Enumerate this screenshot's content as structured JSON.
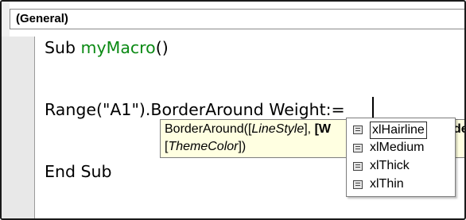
{
  "combo": {
    "value": "(General)"
  },
  "code": {
    "line1_prefix": "Sub ",
    "line1_name": "myMacro",
    "line1_suffix": "()",
    "line3": "Range(\"A1\").BorderAround Weight:=",
    "line5": "End Sub"
  },
  "tooltip": {
    "p1": "BorderAround([",
    "p2": "LineStyle",
    "p3": "], ",
    "p4": "[W",
    "p5": "de",
    "line2_a": "[",
    "line2_b": "ThemeColor",
    "line2_c": "])"
  },
  "autocomplete": {
    "items": [
      {
        "label": "xlHairline",
        "icon": "constant-icon",
        "selected": true
      },
      {
        "label": "xlMedium",
        "icon": "constant-icon",
        "selected": false
      },
      {
        "label": "xlThick",
        "icon": "constant-icon",
        "selected": false
      },
      {
        "label": "xlThin",
        "icon": "constant-icon",
        "selected": false
      }
    ]
  },
  "colors": {
    "keyword_green": "#0b8a14",
    "tooltip_bg": "#ffffe1"
  }
}
